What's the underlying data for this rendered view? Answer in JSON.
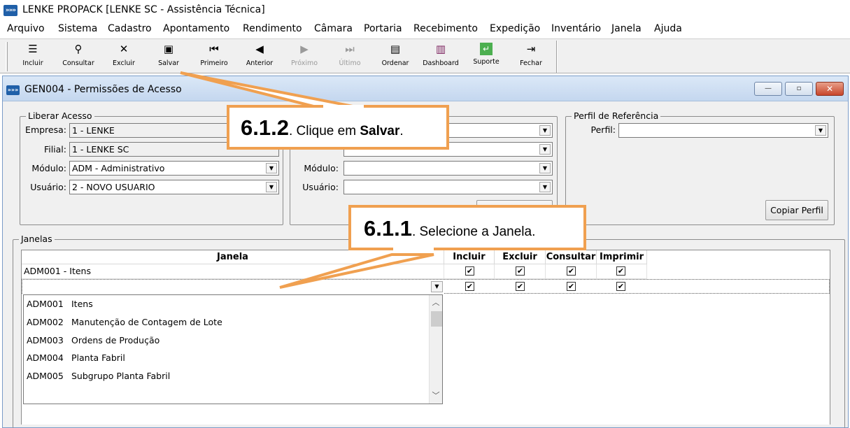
{
  "app": {
    "title": "LENKE PROPACK [LENKE SC - Assistência Técnica]",
    "logo": "»»»"
  },
  "menu": [
    {
      "label": "Arquivo"
    },
    {
      "label": "Sistema"
    },
    {
      "label": "Cadastro"
    },
    {
      "label": "Apontamento"
    },
    {
      "label": "Rendimento"
    },
    {
      "label": "Câmara"
    },
    {
      "label": "Portaria"
    },
    {
      "label": "Recebimento"
    },
    {
      "label": "Expedição"
    },
    {
      "label": "Inventário"
    },
    {
      "label": "Janela"
    },
    {
      "label": "Ajuda"
    }
  ],
  "toolbar": {
    "buttons": [
      {
        "label": "Incluir",
        "icon": "add-record-icon",
        "glyph": "☰"
      },
      {
        "label": "Consultar",
        "icon": "search-icon",
        "glyph": "⚲"
      },
      {
        "label": "Excluir",
        "icon": "delete-record-icon",
        "glyph": "✕"
      },
      {
        "label": "Salvar",
        "icon": "save-icon",
        "glyph": "▣"
      },
      {
        "label": "Primeiro",
        "icon": "first-record-icon",
        "glyph": "⏮"
      },
      {
        "label": "Anterior",
        "icon": "previous-record-icon",
        "glyph": "◀"
      },
      {
        "label": "Próximo",
        "icon": "next-record-icon",
        "glyph": "▶"
      },
      {
        "label": "Último",
        "icon": "last-record-icon",
        "glyph": "⏭"
      },
      {
        "label": "Ordenar",
        "icon": "sort-icon",
        "glyph": "▤"
      },
      {
        "label": "Dashboard",
        "icon": "dashboard-chart-icon",
        "glyph": "▥"
      },
      {
        "label": "Suporte",
        "icon": "support-icon",
        "glyph": "↵"
      },
      {
        "label": "Fechar",
        "icon": "exit-door-icon",
        "glyph": "⇥"
      }
    ]
  },
  "window": {
    "title": "GEN004 - Permissões de Acesso",
    "logo": "»»»",
    "minimize": "—",
    "restore": "▫",
    "close": "✕"
  },
  "liberar": {
    "title": "Liberar Acesso",
    "empresa_label": "Empresa:",
    "empresa_value": "1 - LENKE",
    "filial_label": "Filial:",
    "filial_value": "1 - LENKE SC",
    "modulo_label": "Módulo:",
    "modulo_value": "ADM - Administrativo",
    "usuario_label": "Usuário:",
    "usuario_value": "2 - NOVO USUARIO"
  },
  "middle": {
    "modulo_label": "Módulo:",
    "modulo_value": "",
    "usuario_label": "Usuário:",
    "usuario_value": ""
  },
  "perfil": {
    "title": "Perfil de Referência",
    "perfil_label": "Perfil:",
    "perfil_value": "",
    "copy_button": "Copiar Perfil"
  },
  "janelas": {
    "title": "Janelas",
    "columns": [
      "Janela",
      "Incluir",
      "Excluir",
      "Consultar",
      "Imprimir"
    ],
    "rows": [
      {
        "janela": "ADM001 - Itens",
        "checks": [
          true,
          true,
          true,
          true
        ]
      },
      {
        "janela": "",
        "checks": [
          true,
          true,
          true,
          true
        ]
      }
    ],
    "dropdown": [
      {
        "code": "ADM001",
        "name": "Itens"
      },
      {
        "code": "ADM002",
        "name": "Manutenção de Contagem de Lote"
      },
      {
        "code": "ADM003",
        "name": "Ordens de Produção"
      },
      {
        "code": "ADM004",
        "name": "Planta Fabril"
      },
      {
        "code": "ADM005",
        "name": "Subgrupo Planta Fabril"
      }
    ]
  },
  "callouts": {
    "save": {
      "number": "6.1.2",
      "text1": ". Clique em ",
      "bold": "Salvar",
      "text2": "."
    },
    "select": {
      "number": "6.1.1",
      "text": ". Selecione a Janela."
    }
  },
  "colors": {
    "callout_border": "#f0a050",
    "title_gradient": "#c4d7ef"
  }
}
